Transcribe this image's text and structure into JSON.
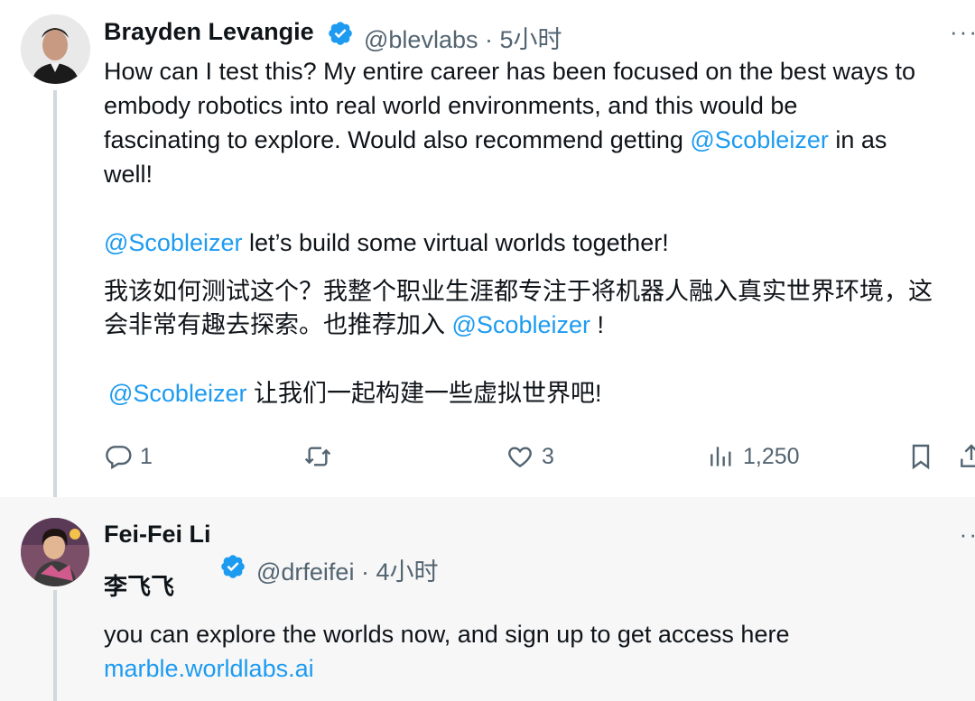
{
  "tweet1": {
    "author_name": "Brayden Levangie",
    "handle": "@blevlabs",
    "time": "5小时",
    "more": "···",
    "en": {
      "l1": "How can I test this? My entire career has been focused on the best ways to",
      "l2": "embody robotics into real world environments, and this would be",
      "l3_pre": "fascinating to explore. Would also recommend getting ",
      "l3_link": "@Scobleizer",
      "l3_post": " in as",
      "l4": "well!",
      "l5_link": "@Scobleizer",
      "l5_post": " let’s build some virtual worlds together!"
    },
    "zh": {
      "l1": "我该如何测试这个？我整个职业生涯都专注于将机器人融入真实世界环境，这",
      "l2_pre": "会非常有趣去探索。也推荐加入 ",
      "l2_link": "@Scobleizer",
      "l2_post": " !",
      "l3_link": "@Scobleizer",
      "l3_post": " 让我们一起构建一些虚拟世界吧!"
    },
    "actions": {
      "replies": "1",
      "retweets": "",
      "likes": "3",
      "views": "1,250"
    }
  },
  "tweet2": {
    "author_name": "Fei-Fei Li",
    "author_name_zh": "李飞飞",
    "handle": "@drfeifei",
    "time": "4小时",
    "more": "··",
    "text_l1": "you can explore the worlds now, and sign up to get access here",
    "link": "marble.worldlabs.ai"
  },
  "colors": {
    "link": "#1d9bf0",
    "verified": "#1d9bf0",
    "secondary_text": "#536471"
  },
  "icons": [
    "verified-badge-icon",
    "reply-icon",
    "retweet-icon",
    "like-icon",
    "views-icon",
    "bookmark-icon",
    "share-icon",
    "more-icon"
  ]
}
